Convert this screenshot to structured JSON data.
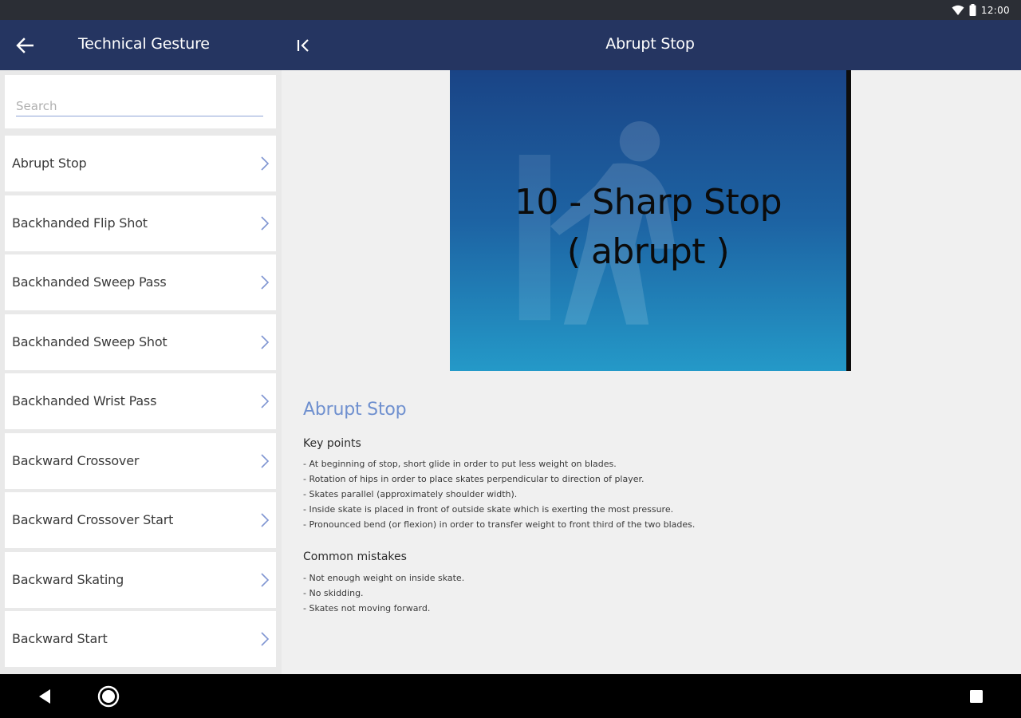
{
  "status_bar": {
    "time": "12:00",
    "icons": [
      "wifi-icon",
      "battery-icon"
    ]
  },
  "app_bar": {
    "left_title": "Technical Gesture",
    "center_title": "Abrupt Stop",
    "icons": [
      "arrow-left-icon",
      "collapse-panel-icon"
    ],
    "colors": {
      "app_bar": "#253561",
      "status_bar": "#2b2e35",
      "accent": "#6f90cf"
    }
  },
  "search": {
    "placeholder": "Search",
    "value": ""
  },
  "list": {
    "items": [
      {
        "label": "Abrupt Stop"
      },
      {
        "label": "Backhanded Flip Shot"
      },
      {
        "label": "Backhanded Sweep Pass"
      },
      {
        "label": "Backhanded Sweep Shot"
      },
      {
        "label": "Backhanded Wrist Pass"
      },
      {
        "label": "Backward Crossover"
      },
      {
        "label": "Backward Crossover Start"
      },
      {
        "label": "Backward Skating"
      },
      {
        "label": "Backward Start"
      }
    ],
    "item_icon": "chevron-right-icon"
  },
  "video": {
    "title_line1": "10 - Sharp Stop",
    "title_line2": "( abrupt )"
  },
  "detail": {
    "title": "Abrupt Stop",
    "key_points_heading": "Key points",
    "key_points": [
      "- At beginning of stop, short glide in order to put less weight on blades.",
      "- Rotation of hips in order to place skates perpendicular to direction of player.",
      "- Skates parallel (approximately shoulder width).",
      "- Inside skate is placed in front of outside skate which is exerting the most pressure.",
      "- Pronounced bend (or flexion) in order to transfer weight to front third of the two blades."
    ],
    "mistakes_heading": "Common mistakes",
    "mistakes": [
      "- Not enough weight on inside skate.",
      "- No skidding.",
      "- Skates not moving forward."
    ]
  },
  "nav_bar": {
    "icons": [
      "nav-back-icon",
      "nav-home-icon",
      "nav-recents-icon"
    ]
  }
}
